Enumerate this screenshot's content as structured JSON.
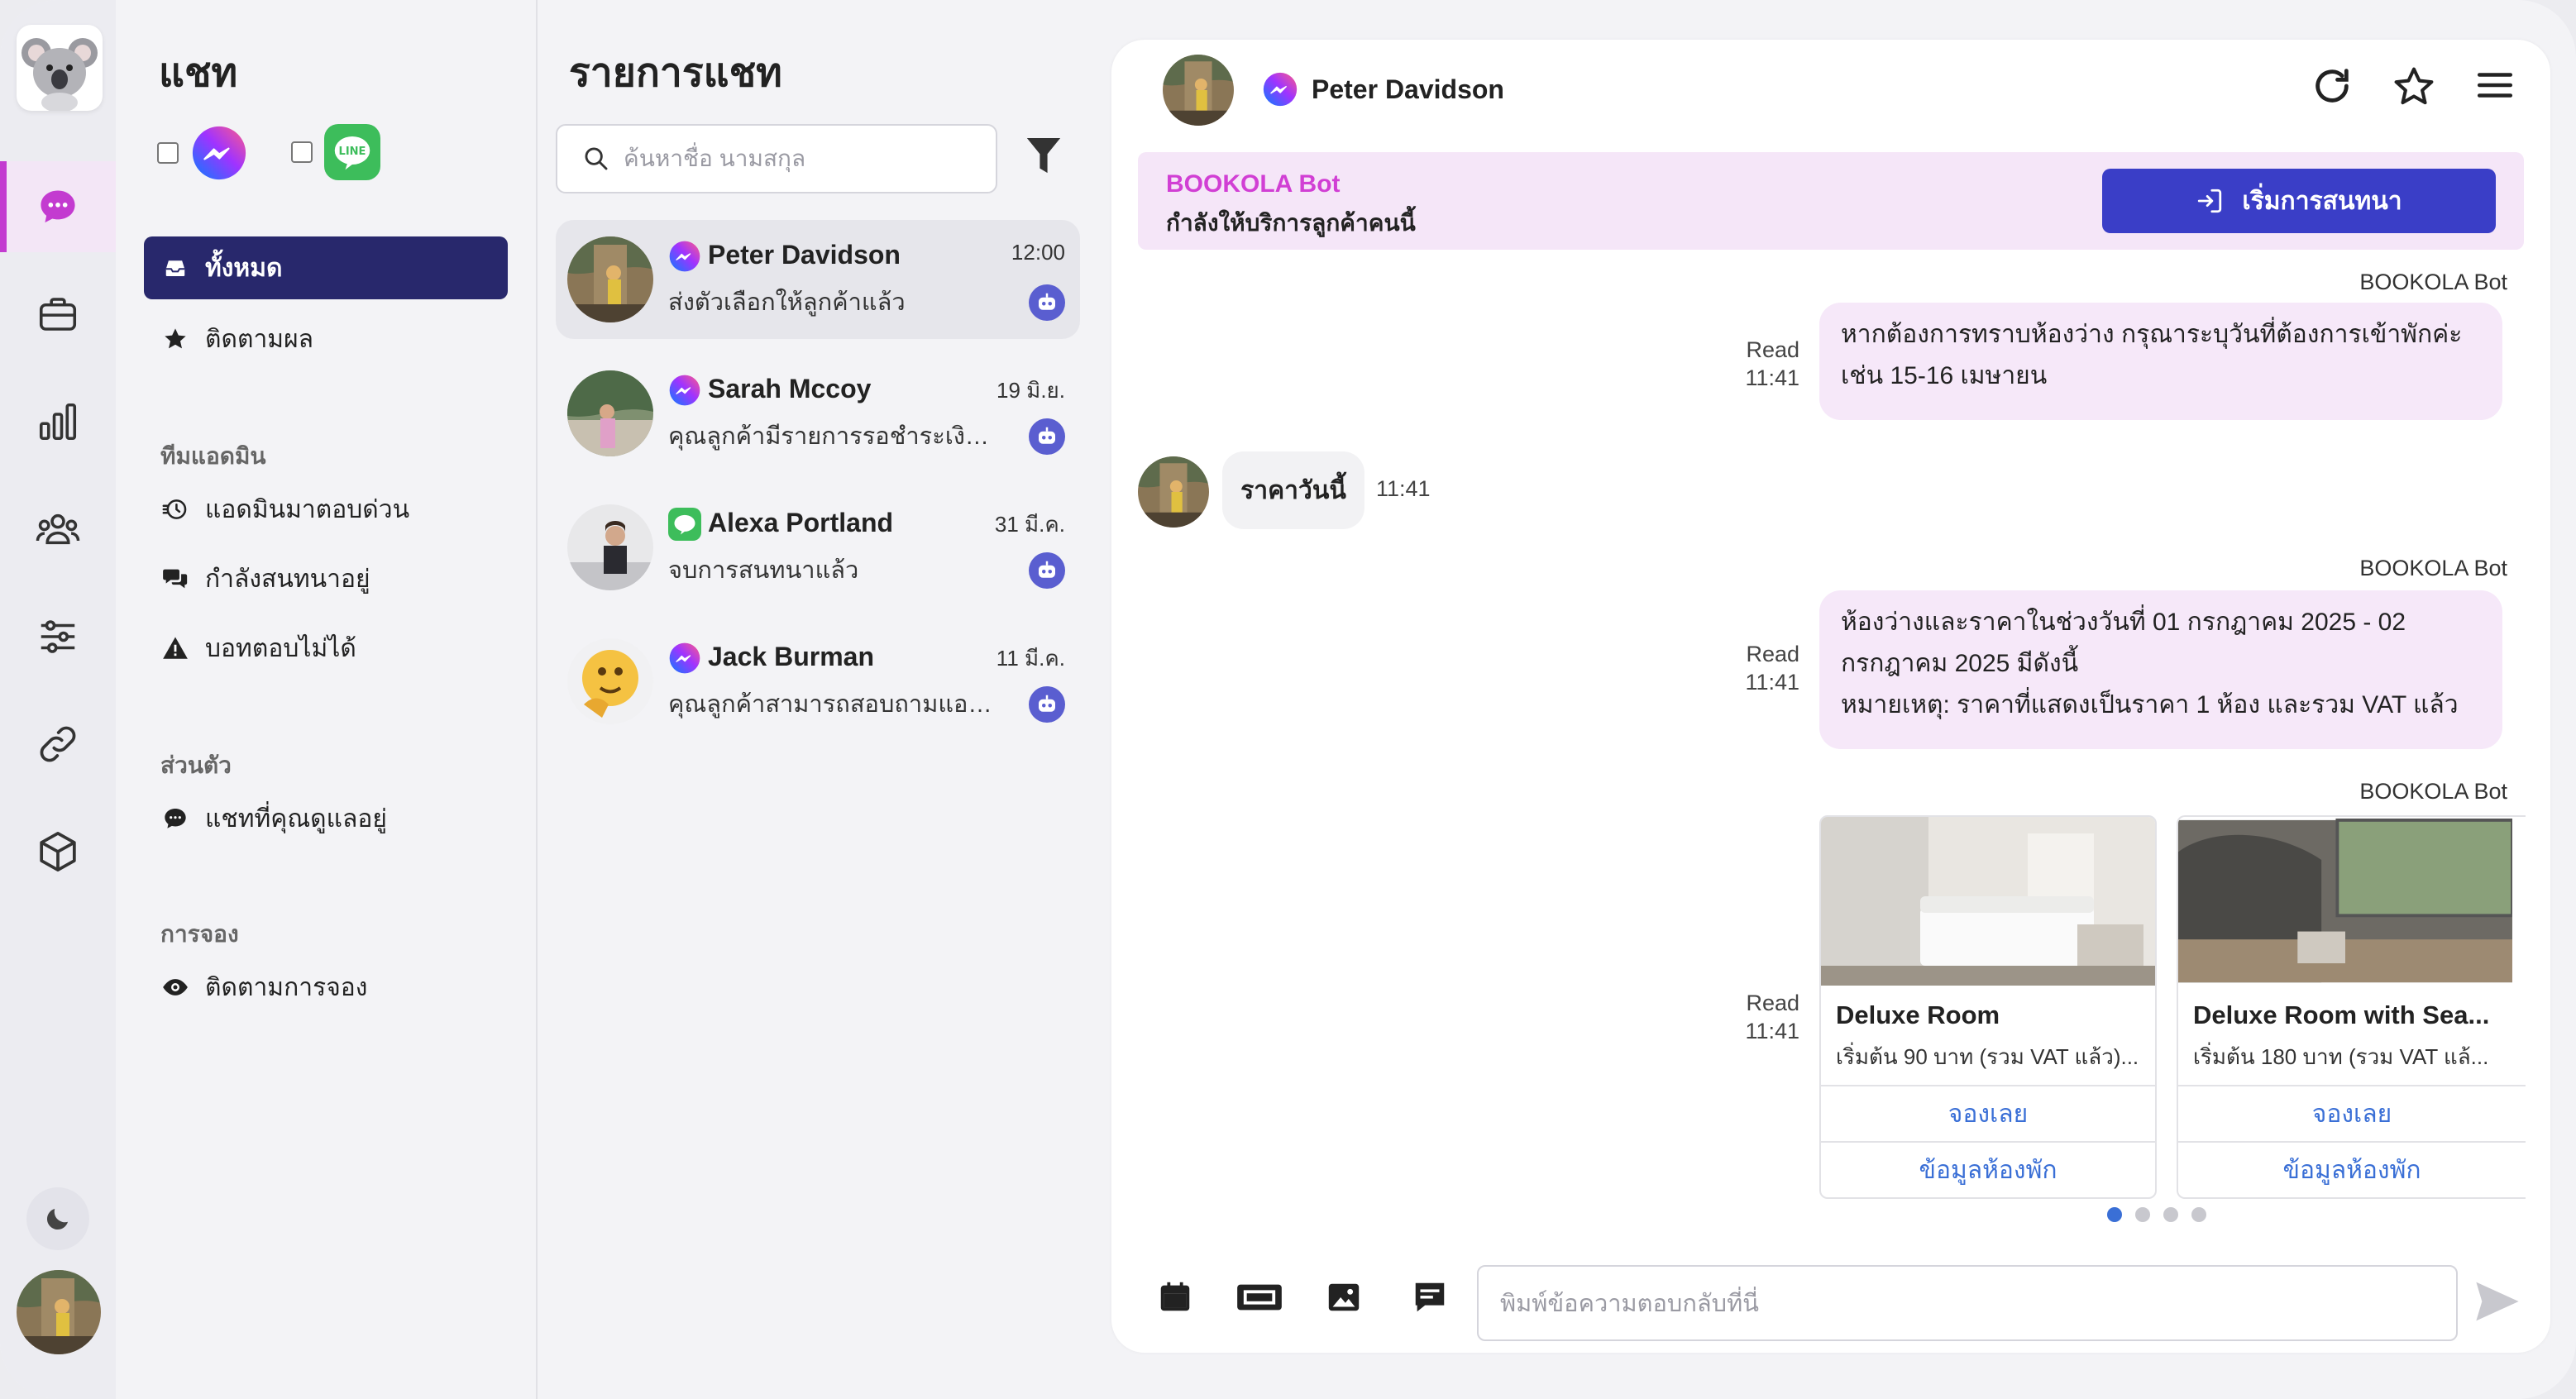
{
  "sidebar": {
    "title": "แชท",
    "nav": {
      "all": "ทั้งหมด",
      "follow": "ติดตามผล"
    },
    "team_label": "ทีมแอดมิน",
    "team": {
      "admin_quick": "แอดมินมาตอบด่วน",
      "chatting": "กำลังสนทนาอยู่",
      "cannot_answer": "บอทตอบไม่ได้"
    },
    "personal_label": "ส่วนตัว",
    "personal": {
      "my_chats": "แชทที่คุณดูแลอยู่"
    },
    "booking_label": "การจอง",
    "booking": {
      "track": "ติดตามการจอง"
    }
  },
  "chatlist": {
    "title": "รายการแชท",
    "search_placeholder": "ค้นหาชื่อ นามสกุล",
    "items": [
      {
        "name": "Peter Davidson",
        "preview": "ส่งตัวเลือกให้ลูกค้าแล้ว",
        "time": "12:00",
        "channel": "messenger"
      },
      {
        "name": "Sarah Mccoy",
        "preview": "คุณลูกค้ามีรายการรอชำระเงิน...",
        "time": "19 มิ.ย.",
        "channel": "messenger"
      },
      {
        "name": "Alexa Portland",
        "preview": "จบการสนทนาแล้ว",
        "time": "31 มี.ค.",
        "channel": "line"
      },
      {
        "name": "Jack Burman",
        "preview": "คุณลูกค้าสามารถสอบถามแอด...",
        "time": "11 มี.ค.",
        "channel": "messenger"
      }
    ]
  },
  "chat": {
    "header_name": "Peter Davidson",
    "banner": {
      "bot_name": "BOOKOLA Bot",
      "status": "กำลังให้บริการลูกค้าคนนี้",
      "start_button": "เริ่มการสนทนา"
    },
    "messages": {
      "m1": {
        "sender": "BOOKOLA Bot",
        "read": "Read",
        "time": "11:41",
        "line1": "หากต้องการทราบห้องว่าง กรุณาระบุวันที่ต้องการเข้าพักค่ะ",
        "line2": "เช่น 15-16 เมษายน"
      },
      "m2": {
        "text": "ราคาวันนี้",
        "time": "11:41"
      },
      "m3": {
        "sender": "BOOKOLA Bot",
        "read": "Read",
        "time": "11:41",
        "line1": "ห้องว่างและราคาในช่วงวันที่ 01 กรกฎาคม 2025 - 02",
        "line2": "กรกฎาคม 2025 มีดังนี้",
        "line3": "หมายเหตุ: ราคาที่แสดงเป็นราคา 1 ห้อง และรวม VAT แล้ว"
      },
      "m4": {
        "sender": "BOOKOLA Bot",
        "read": "Read",
        "time": "11:41"
      }
    },
    "cards": [
      {
        "title": "Deluxe Room",
        "subtitle": "เริ่มต้น 90 บาท (รวม VAT แล้ว)...",
        "book": "จองเลย",
        "info": "ข้อมูลห้องพัก"
      },
      {
        "title": "Deluxe Room with Sea...",
        "subtitle": "เริ่มต้น 180 บาท (รวม VAT แล้...",
        "book": "จองเลย",
        "info": "ข้อมูลห้องพัก"
      }
    ],
    "carousel_active": 1,
    "carousel_count": 4,
    "composer_placeholder": "พิมพ์ข้อความตอบกลับที่นี่"
  },
  "colors": {
    "accent": "#c33bd0",
    "primary": "#3a3ec7",
    "nav_active": "#28286c",
    "bot_bubble": "#f6e8f9",
    "link": "#3a6fd6"
  }
}
